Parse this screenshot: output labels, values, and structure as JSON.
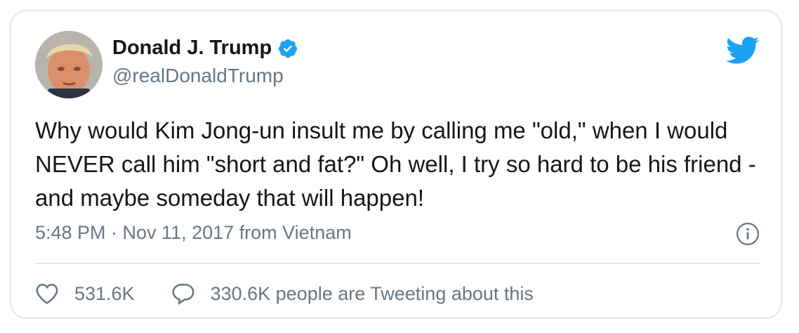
{
  "tweet": {
    "user_name": "Donald J. Trump",
    "handle": "@realDonaldTrump",
    "text": "Why would Kim Jong-un insult me by calling me \"old,\" when I would NEVER call him \"short and fat?\" Oh well, I try so hard to be his friend - and maybe someday that will happen!",
    "meta": "5:48 PM · Nov 11, 2017 from Vietnam",
    "likes": "531.6K",
    "reply_text": "330.6K people are Tweeting about this"
  },
  "icons": {
    "brand": "twitter-bird-icon",
    "verified": "verified-badge-icon",
    "info": "info-icon",
    "like": "heart-icon",
    "reply": "speech-bubble-icon"
  },
  "colors": {
    "twitter_blue": "#1da1f2",
    "text_primary": "#14171a",
    "text_secondary": "#657786",
    "border": "#e1e8ed"
  }
}
